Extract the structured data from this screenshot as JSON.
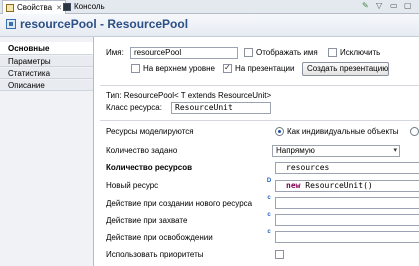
{
  "tabs": [
    {
      "label": "Свойства",
      "active": true
    },
    {
      "label": "Консоль",
      "active": false
    }
  ],
  "title": "resourcePool - ResourcePool",
  "sidebar": {
    "items": [
      {
        "label": "Основные",
        "active": true
      },
      {
        "label": "Параметры",
        "active": false
      },
      {
        "label": "Статистика",
        "active": false
      },
      {
        "label": "Описание",
        "active": false
      }
    ]
  },
  "general": {
    "name_label": "Имя:",
    "name_value": "resourcePool",
    "show_name_label": "Отображать имя",
    "show_name_checked": false,
    "exclude_label": "Исключить",
    "exclude_checked": false,
    "top_level_label": "На верхнем уровне",
    "top_level_checked": false,
    "on_presentation_label": "На презентации",
    "on_presentation_checked": true,
    "create_presentation_button": "Создать презентацию"
  },
  "type_info": {
    "type_line": "Тип: ResourcePool< T extends ResourceUnit>",
    "resource_class_label": "Класс ресурса:",
    "resource_class_value": "ResourceUnit"
  },
  "properties": {
    "modeled_label": "Ресурсы моделируются",
    "modeled_option": "Как индивидуальные объекты",
    "quantity_set_label": "Количество задано",
    "quantity_set_value": "Напрямую",
    "count_label": "Количество ресурсов",
    "count_value": "resources",
    "new_resource_label": "Новый ресурс",
    "new_resource_mode": "D",
    "new_resource_keyword": "new",
    "new_resource_expr": " ResourceUnit()",
    "on_create_label": "Действие при создании нового ресурса",
    "on_create_mode": "c",
    "on_seize_label": "Действие при захвате",
    "on_seize_mode": "c",
    "on_release_label": "Действие при освобождении",
    "on_release_mode": "c",
    "use_priorities_label": "Использовать приоритеты",
    "use_priorities_checked": false
  }
}
